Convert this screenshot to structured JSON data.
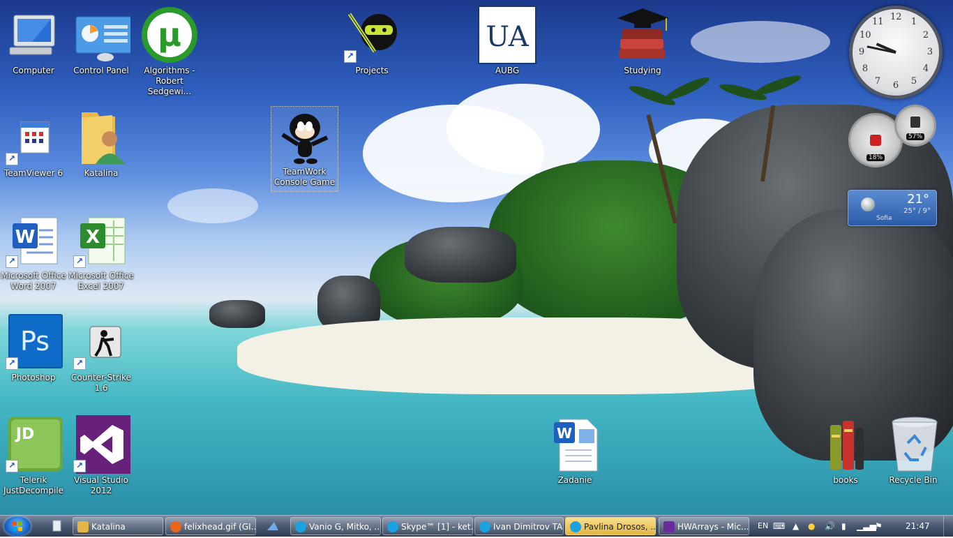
{
  "desktop": {
    "icons": [
      {
        "label": "Computer"
      },
      {
        "label": "Control Panel"
      },
      {
        "label": "Algorithms - Robert Sedgewi..."
      },
      {
        "label": "Projects"
      },
      {
        "label": "AUBG"
      },
      {
        "label": "Studying"
      },
      {
        "label": "TeamViewer 6"
      },
      {
        "label": "Katalina"
      },
      {
        "label": "TeamWork Console Game"
      },
      {
        "label": "Microsoft Office Word 2007"
      },
      {
        "label": "Microsoft Office Excel 2007"
      },
      {
        "label": "Photoshop"
      },
      {
        "label": "Counter-Strike 1.6"
      },
      {
        "label": "Telerik JustDecompile"
      },
      {
        "label": "Visual Studio 2012"
      },
      {
        "label": "Zadanie"
      },
      {
        "label": "books"
      },
      {
        "label": "Recycle Bin"
      }
    ],
    "icon_glyphs": {
      "photoshop": "Ps",
      "justdecompile": "JD",
      "utorrent": "µ",
      "aubg": "UA"
    }
  },
  "gadgets": {
    "clock": {
      "numbers": [
        "12",
        "1",
        "2",
        "3",
        "4",
        "5",
        "6",
        "7",
        "8",
        "9",
        "10",
        "11"
      ],
      "hour": 9,
      "minute": 47
    },
    "cpu_meter": {
      "cpu_percent": "18%",
      "memory_percent": "57%"
    },
    "weather": {
      "temperature": "21°",
      "range": "25° / 9°",
      "city": "Sofia"
    }
  },
  "taskbar": {
    "buttons": [
      {
        "label": "Katalina",
        "color": "#d9a54a"
      },
      {
        "label": "felixhead.gif (GI...",
        "color": "#e8661c"
      },
      {
        "label": "Vanio G, Mitko, ...",
        "color": "#1aa3e0"
      },
      {
        "label": "Skype™ [1] - ket...",
        "color": "#1aa3e0"
      },
      {
        "label": "Ivan Dimitrov TA",
        "color": "#1aa3e0"
      },
      {
        "label": "Pavlina Drosos, ...",
        "color": "#1aa3e0"
      },
      {
        "label": "HWArrays - Mic...",
        "color": "#6a2c9c"
      }
    ],
    "tray": {
      "language": "EN",
      "time": "21:47"
    }
  },
  "colors": {
    "taskbar": "#3a4a62",
    "active_button": "#e8c25a"
  }
}
